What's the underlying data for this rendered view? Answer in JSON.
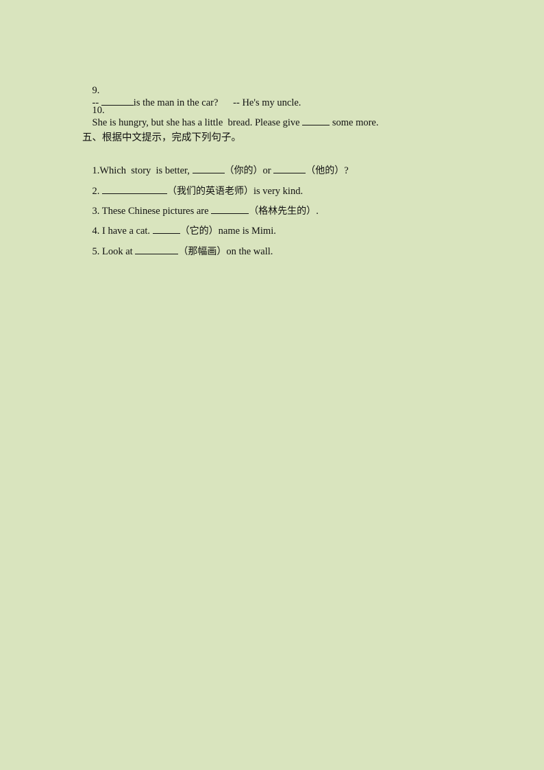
{
  "document": {
    "background_color": "#d9e4be",
    "previous_section": {
      "items": [
        {
          "number": "9.",
          "parts": [
            "-- ",
            "is the man in the car?",
            "      -- He's my uncle."
          ]
        },
        {
          "number": "10.",
          "parts": [
            "She is hungry, but she has a little  bread. Please give ",
            " some more."
          ]
        }
      ]
    },
    "section_five": {
      "heading": "五、根据中文提示，完成下列句子。",
      "items": [
        {
          "number": "1.",
          "parts": [
            "Which  story  is better, ",
            "（你的）",
            "or ",
            "（他的）",
            "?"
          ]
        },
        {
          "number": "2.",
          "parts": [
            "（我们的英语老师）",
            "is very kind."
          ]
        },
        {
          "number": "3.",
          "parts": [
            "These Chinese pictures are ",
            "（格林先生的）",
            "."
          ]
        },
        {
          "number": "4.",
          "parts": [
            "I have a cat. ",
            "（它的）",
            "name is Mimi."
          ]
        },
        {
          "number": "5.",
          "parts": [
            "Look at ",
            "（那幅画）",
            "on the wall."
          ]
        }
      ]
    }
  }
}
